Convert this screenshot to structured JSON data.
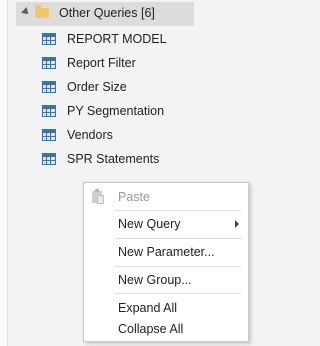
{
  "tree": {
    "group": {
      "label": "Other Queries [6]"
    },
    "queries": [
      {
        "label": "REPORT MODEL"
      },
      {
        "label": "Report Filter"
      },
      {
        "label": "Order Size"
      },
      {
        "label": "PY Segmentation"
      },
      {
        "label": "Vendors"
      },
      {
        "label": "SPR Statements"
      }
    ]
  },
  "context_menu": {
    "paste": "Paste",
    "new_query": "New Query",
    "new_parameter": "New Parameter...",
    "new_group": "New Group...",
    "expand_all": "Expand All",
    "collapse_all": "Collapse All"
  }
}
